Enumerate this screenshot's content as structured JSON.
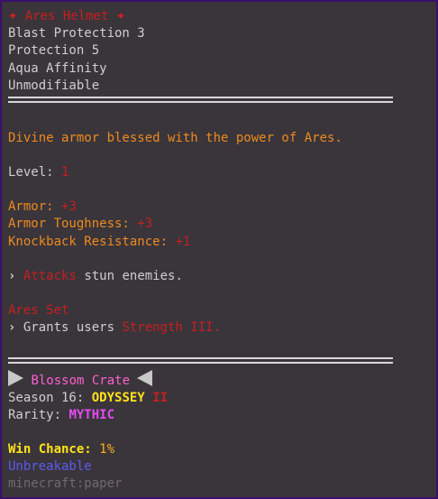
{
  "item": {
    "name": "Ares Helmet",
    "star_glyph": "✦",
    "enchantments": [
      "Blast Protection 3",
      "Protection 5",
      "Aqua Affinity",
      "Unmodifiable"
    ],
    "description": "Divine armor blessed with the power of Ares.",
    "level_label": "Level:",
    "level_value": "1",
    "stats": {
      "armor_label": "Armor:",
      "armor_value": "+3",
      "toughness_label": "Armor Toughness:",
      "toughness_value": "+3",
      "knockback_label": "Knockback Resistance:",
      "knockback_value": "+1"
    },
    "ability": {
      "arrow": "›",
      "keyword": "Attacks",
      "text": "stun enemies."
    },
    "set": {
      "name": "Ares Set",
      "arrow": "›",
      "text": "Grants users",
      "effect": "Strength III."
    },
    "crate": {
      "name": "Blossom Crate",
      "season_label": "Season 16:",
      "season_name": "ODYSSEY",
      "season_numeral": "II",
      "rarity_label": "Rarity:",
      "rarity_value": "MYTHIC",
      "win_label": "Win Chance:",
      "win_value": "1%"
    },
    "unbreakable": "Unbreakable",
    "item_id": "minecraft:paper"
  },
  "colors": {
    "background": "#3a353b",
    "border": "#3b0f6b",
    "name": "#c61f1f",
    "description": "#ee8a1e",
    "rarity": "#e44cf0",
    "unbreakable": "#5a5af0"
  }
}
